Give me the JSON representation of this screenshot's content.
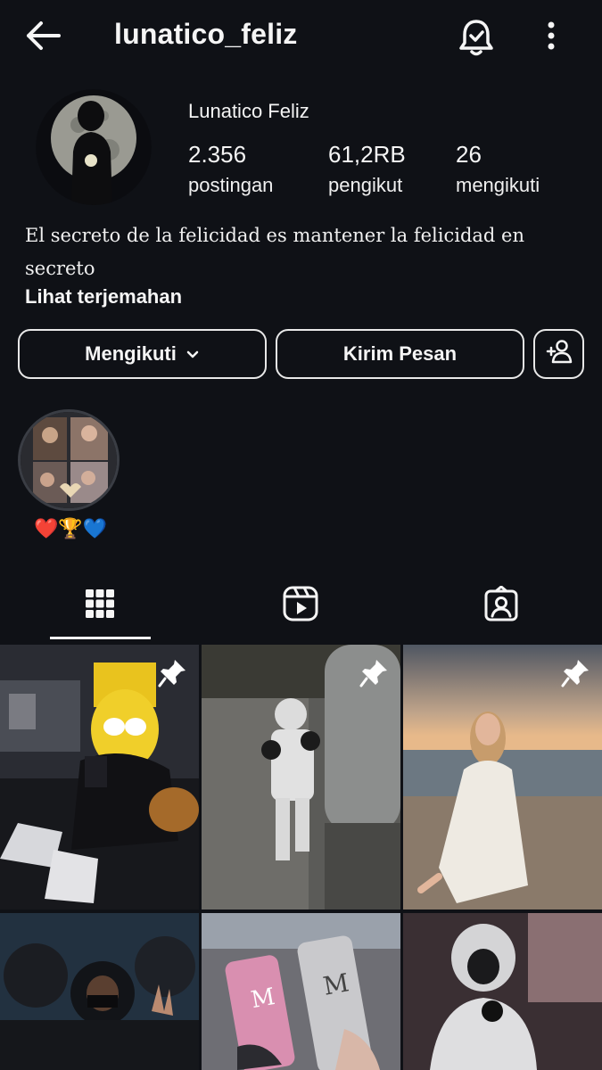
{
  "header": {
    "username": "lunatico_feliz"
  },
  "profile": {
    "display_name": "Lunatico Feliz",
    "stats": [
      {
        "value": "2.356",
        "label": "postingan"
      },
      {
        "value": "61,2RB",
        "label": "pengikut"
      },
      {
        "value": "26",
        "label": "mengikuti"
      }
    ],
    "bio": "El secreto de la felicidad es mantener la felicidad en secreto",
    "translate_link": "Lihat terjemahan"
  },
  "actions": {
    "follow_label": "Mengikuti",
    "message_label": "Kirim Pesan"
  },
  "highlights": [
    {
      "label": "❤️🏆💙"
    }
  ],
  "tabs": [
    {
      "icon": "grid-icon",
      "active": true
    },
    {
      "icon": "reels-icon",
      "active": false
    },
    {
      "icon": "tagged-icon",
      "active": false
    }
  ],
  "grid": {
    "posts": [
      {
        "subject": "cartoon character in car",
        "pinned": true
      },
      {
        "subject": "child boxing",
        "pinned": true
      },
      {
        "subject": "woman on beach",
        "pinned": true
      },
      {
        "subject": "hooded group",
        "pinned": false
      },
      {
        "subject": "energy drink cans",
        "pinned": false
      },
      {
        "subject": "hooded person",
        "pinned": false
      }
    ]
  },
  "colors": {
    "background": "#0f1116",
    "text": "#f5f5f5",
    "border": "#e8e8e8"
  }
}
